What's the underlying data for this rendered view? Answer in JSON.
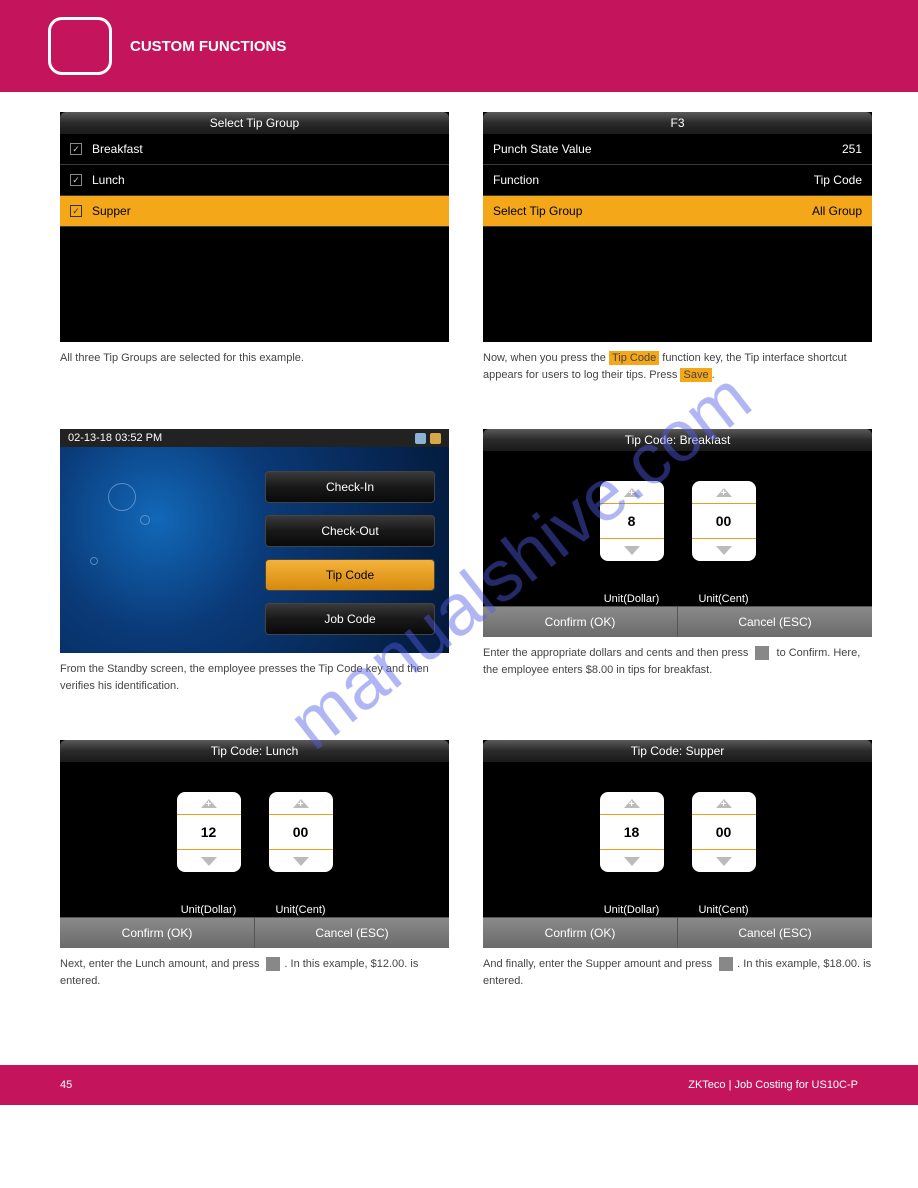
{
  "header": {
    "label": "CUSTOM FUNCTIONS"
  },
  "watermark": "manualshive.com",
  "panel1": {
    "title": "Select Tip Group",
    "items": [
      {
        "label": "Breakfast",
        "selected": false
      },
      {
        "label": "Lunch",
        "selected": false
      },
      {
        "label": "Supper",
        "selected": true
      }
    ],
    "caption": "All three Tip Groups are selected for this example."
  },
  "panel2": {
    "title": "F3",
    "rows": [
      {
        "k": "Punch State Value",
        "v": "251",
        "sel": false
      },
      {
        "k": "Function",
        "v": "Tip Code",
        "sel": false
      },
      {
        "k": "Select Tip Group",
        "v": "All Group",
        "sel": true
      }
    ],
    "caption_a": "Now, when you press the ",
    "caption_hl1": "Tip Code",
    "caption_b": " function key, the Tip interface shortcut appears for users to log their tips. Press ",
    "caption_hl2": "Save",
    "caption_c": "."
  },
  "panel3": {
    "datetime": "02-13-18 03:52 PM",
    "buttons": [
      {
        "label": "Check-In",
        "sel": false
      },
      {
        "label": "Check-Out",
        "sel": false
      },
      {
        "label": "Tip Code",
        "sel": true
      },
      {
        "label": "Job Code",
        "sel": false
      }
    ],
    "caption": "From the Standby screen, the employee presses the Tip Code key and then verifies his identification."
  },
  "panel4": {
    "title": "Tip Code: Breakfast",
    "dollar": "8",
    "cent": "00",
    "unit_dollar": "Unit(Dollar)",
    "unit_cent": "Unit(Cent)",
    "confirm": "Confirm (OK)",
    "cancel": "Cancel (ESC)",
    "caption_a": "Enter the appropriate dollars and cents and then press ",
    "caption_b": " to Confirm. Here, the employee enters $8.00 in tips for breakfast."
  },
  "panel5": {
    "title": "Tip Code: Lunch",
    "dollar": "12",
    "cent": "00",
    "unit_dollar": "Unit(Dollar)",
    "unit_cent": "Unit(Cent)",
    "confirm": "Confirm (OK)",
    "cancel": "Cancel (ESC)",
    "caption_a": "Next, enter the Lunch amount, and press ",
    "caption_b": ". In this example, $12.00. is entered."
  },
  "panel6": {
    "title": "Tip Code: Supper",
    "dollar": "18",
    "cent": "00",
    "unit_dollar": "Unit(Dollar)",
    "unit_cent": "Unit(Cent)",
    "confirm": "Confirm (OK)",
    "cancel": "Cancel (ESC)",
    "caption_a": "And finally, enter the Supper amount and press ",
    "caption_b": ". In this example, $18.00. is entered."
  },
  "footer": {
    "left": "45",
    "right": "ZKTeco | Job Costing for US10C-P"
  }
}
